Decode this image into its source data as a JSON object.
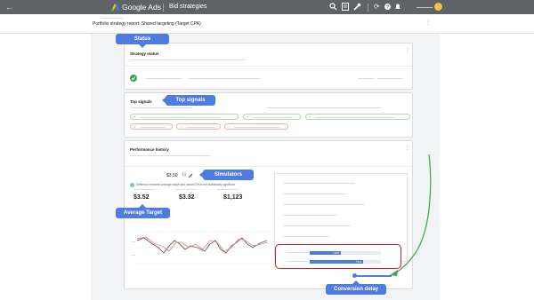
{
  "topbar": {
    "product_name": "Google Ads",
    "page_name": "Bid strategies"
  },
  "report": {
    "title": "Portfolio strategy report: Shared targeting (Target CPA)"
  },
  "cards": {
    "strategy_status_title": "Strategy status",
    "top_signals_title": "Top signals",
    "performance_history_title": "Performance history"
  },
  "simulator": {
    "target_value": "$3.50",
    "note": "Difference between average target and actual CPA is not statistically significant"
  },
  "metrics": [
    "$3.52",
    "$3.32",
    "$1,123"
  ],
  "conversion_delay": {
    "bar1_label": "44%",
    "bar2_label": "75%",
    "bar1_fraction": 0.44,
    "bar2_fraction": 0.75
  },
  "callouts": {
    "status": "Status",
    "top_signals": "Top signals",
    "simulators": "Simulators",
    "average_target": "Average Target",
    "conversion_delay": "Conversion delay"
  },
  "colors": {
    "accent": "#4f7ce0",
    "topbar": "#5f6368",
    "status_ok": "#34a853",
    "highlight_box": "#c5221f",
    "arrow": "#34a853",
    "line_target": "#ea8b8b",
    "line_actual": "#5f6368"
  },
  "icons": [
    "back-arrow-icon",
    "google-ads-logo",
    "search-icon",
    "reports-icon",
    "tools-icon",
    "refresh-icon",
    "help-icon",
    "notifications-icon",
    "avatar",
    "check-circle-icon",
    "edit-pencil-icon",
    "more-vert-icon"
  ]
}
